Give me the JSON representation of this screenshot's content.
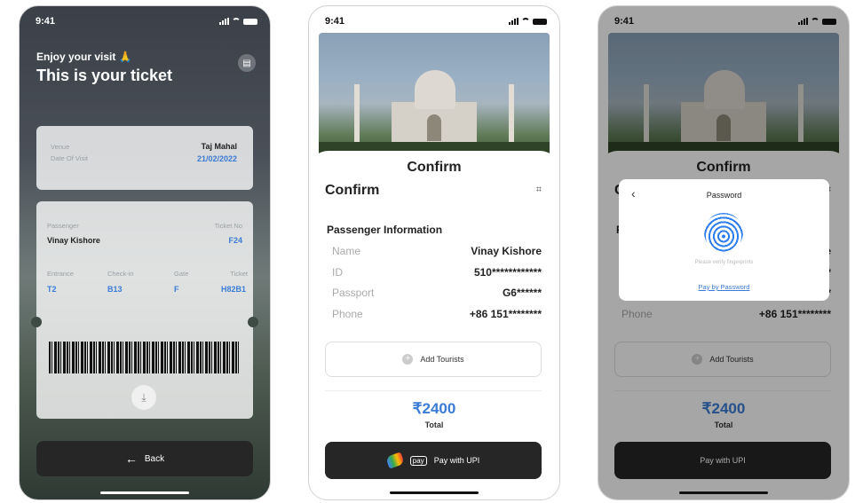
{
  "status": {
    "time": "9:41"
  },
  "ticket": {
    "greeting": "Enjoy your visit 🙏",
    "title": "This is your ticket",
    "venue_label": "Venue",
    "venue": "Taj Mahal",
    "date_label": "Date Of Visit",
    "date": "21/02/2022",
    "passenger_label": "Passenger",
    "passenger": "Vinay Kishore",
    "ticket_no_label": "Ticket No",
    "ticket_no": "F24",
    "entrance_label": "Entrance",
    "entrance": "T2",
    "checkin_label": "Check-in",
    "checkin": "B13",
    "gate_label": "Gate",
    "gate": "F",
    "ticket_label": "Ticket",
    "ticket": "H82B1",
    "back": "Back"
  },
  "confirm": {
    "header": "Confirm",
    "title": "Confirm",
    "section": "Passenger Information",
    "rows": [
      {
        "k": "Name",
        "v": "Vinay Kishore"
      },
      {
        "k": "ID",
        "v": "510************"
      },
      {
        "k": "Passport",
        "v": "G6******"
      },
      {
        "k": "Phone",
        "v": "+86 151********"
      }
    ],
    "add_tourists": "Add Tourists",
    "price": "₹2400",
    "total": "Total",
    "pay": "Pay with UPI",
    "pay_badge": "pay"
  },
  "password_dialog": {
    "title": "Password",
    "hint": "Please verify fingerprints",
    "link": "Pay by Password"
  }
}
